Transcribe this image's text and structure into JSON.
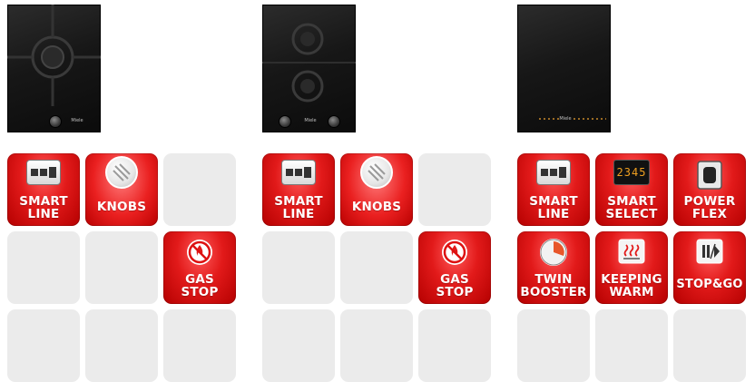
{
  "columns": [
    {
      "cooktop_brand": "Miele",
      "features": [
        {
          "type": "smart-line",
          "lines": [
            "SMART",
            "LINE"
          ]
        },
        {
          "type": "knobs",
          "lines": [
            "KNOBS"
          ]
        },
        {
          "type": "empty"
        },
        {
          "type": "empty"
        },
        {
          "type": "empty"
        },
        {
          "type": "gas-stop",
          "lines": [
            "GAS",
            "STOP"
          ]
        },
        {
          "type": "empty"
        },
        {
          "type": "empty"
        },
        {
          "type": "empty"
        }
      ]
    },
    {
      "cooktop_brand": "Miele",
      "features": [
        {
          "type": "smart-line",
          "lines": [
            "SMART",
            "LINE"
          ]
        },
        {
          "type": "knobs",
          "lines": [
            "KNOBS"
          ]
        },
        {
          "type": "empty"
        },
        {
          "type": "empty"
        },
        {
          "type": "empty"
        },
        {
          "type": "gas-stop",
          "lines": [
            "GAS",
            "STOP"
          ]
        },
        {
          "type": "empty"
        },
        {
          "type": "empty"
        },
        {
          "type": "empty"
        }
      ]
    },
    {
      "cooktop_brand": "Miele",
      "features": [
        {
          "type": "smart-line",
          "lines": [
            "SMART",
            "LINE"
          ]
        },
        {
          "type": "smart-select",
          "lines": [
            "SMART",
            "SELECT"
          ],
          "display_digits": "2345"
        },
        {
          "type": "power-flex",
          "lines": [
            "POWER",
            "FLEX"
          ]
        },
        {
          "type": "twin-booster",
          "lines": [
            "TWIN",
            "BOOSTER"
          ]
        },
        {
          "type": "keeping-warm",
          "lines": [
            "KEEPING",
            "WARM"
          ]
        },
        {
          "type": "stop-go",
          "lines": [
            "STOP&GO"
          ]
        },
        {
          "type": "empty"
        },
        {
          "type": "empty"
        },
        {
          "type": "empty"
        }
      ]
    }
  ],
  "colors": {
    "feature_red": "#e21a1a",
    "empty_tile": "#ebebeb",
    "icon_white": "#ffffff"
  }
}
